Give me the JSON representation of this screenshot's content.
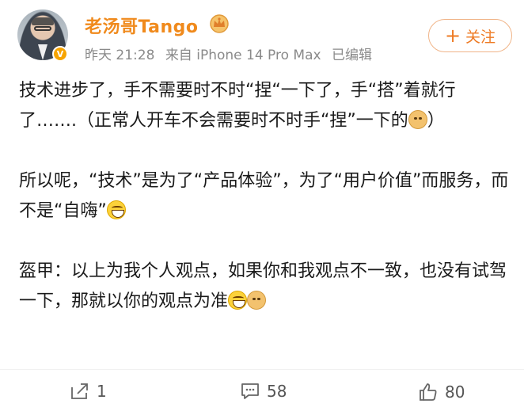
{
  "post": {
    "author": {
      "name": "老汤哥Tango",
      "verified_badge": "V",
      "avatar_icon": "person-avatar",
      "badge_icon": "crown-icon"
    },
    "meta": {
      "time": "昨天 21:28",
      "source": "来自 iPhone 14 Pro Max",
      "edited": "已编辑"
    },
    "follow": {
      "plus": "+",
      "label": "关注"
    },
    "paragraphs": [
      {
        "text": "技术进步了，手不需要时不时“捏“一下了，手“搭”着就行了…….（正常人开车不会需要时不时手“捏”一下的",
        "suffix": "）",
        "emojis": [
          "doge"
        ]
      },
      {
        "text": "所以呢，“技术”是为了“产品体验”，为了“用户价值”而服务，而不是“自嗨”",
        "suffix": "",
        "emojis": [
          "grin"
        ]
      },
      {
        "text": "盔甲：以上为我个人观点，如果你和我观点不一致，也没有试驾一下，那就以你的观点为准",
        "suffix": "",
        "emojis": [
          "grin",
          "doge"
        ]
      }
    ],
    "actions": {
      "repost": {
        "icon": "share-icon",
        "count": "1"
      },
      "comment": {
        "icon": "comment-icon",
        "count": "58"
      },
      "like": {
        "icon": "thumbs-up-icon",
        "count": "80"
      }
    },
    "colors": {
      "accent": "#f08a1c",
      "follow": "#ee7a23",
      "meta": "#8a8a8a",
      "badge": "#f7a400"
    }
  }
}
